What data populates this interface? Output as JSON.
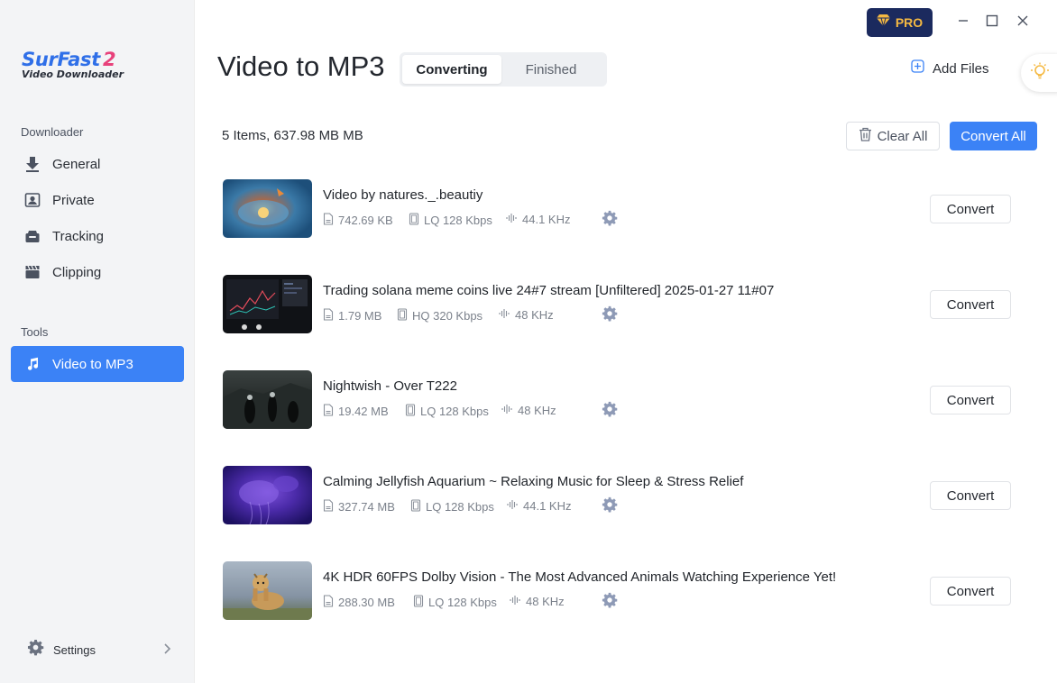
{
  "app": {
    "logo_name": "SurFast",
    "logo_version": "2",
    "logo_subtitle": "Video Downloader",
    "brand_colors": {
      "primary": "#3b82f6",
      "pro_bg": "#1b2a5e",
      "pro_text": "#f5b942"
    }
  },
  "sidebar": {
    "downloader_label": "Downloader",
    "tools_label": "Tools",
    "items": [
      {
        "label": "General",
        "icon": "download-arrow-icon"
      },
      {
        "label": "Private",
        "icon": "private-profile-icon"
      },
      {
        "label": "Tracking",
        "icon": "tracking-icon"
      },
      {
        "label": "Clipping",
        "icon": "clapperboard-icon"
      }
    ],
    "tools": [
      {
        "label": "Video to MP3",
        "icon": "music-note-icon",
        "active": true
      }
    ],
    "settings_label": "Settings"
  },
  "header": {
    "title": "Video to MP3",
    "tabs": [
      {
        "label": "Converting",
        "active": true
      },
      {
        "label": "Finished",
        "active": false
      }
    ],
    "pro_label": "PRO",
    "add_files_label": "Add Files"
  },
  "toolbar": {
    "summary": "5 Items, 637.98 MB MB",
    "clear_all_label": "Clear All",
    "convert_all_label": "Convert All"
  },
  "videos": [
    {
      "title": "Video by natures._.beautiy",
      "size": "742.69 KB",
      "quality": "LQ 128 Kbps",
      "sample_rate": "44.1 KHz",
      "action": "Convert"
    },
    {
      "title": "Trading solana meme coins live 24#7 stream [Unfiltered] 2025-01-27 11#07",
      "size": "1.79 MB",
      "quality": "HQ 320 Kbps",
      "sample_rate": "48 KHz",
      "action": "Convert"
    },
    {
      "title": "Nightwish - Over T222",
      "size": "19.42 MB",
      "quality": "LQ 128 Kbps",
      "sample_rate": "48 KHz",
      "action": "Convert"
    },
    {
      "title": "Calming Jellyfish Aquarium ~ Relaxing Music for Sleep & Stress Relief",
      "size": "327.74 MB",
      "quality": "LQ 128 Kbps",
      "sample_rate": "44.1 KHz",
      "action": "Convert"
    },
    {
      "title": "4K HDR 60FPS Dolby Vision - The Most Advanced Animals Watching Experience Yet!",
      "size": "288.30 MB",
      "quality": "LQ 128 Kbps",
      "sample_rate": "48 KHz",
      "action": "Convert"
    }
  ]
}
